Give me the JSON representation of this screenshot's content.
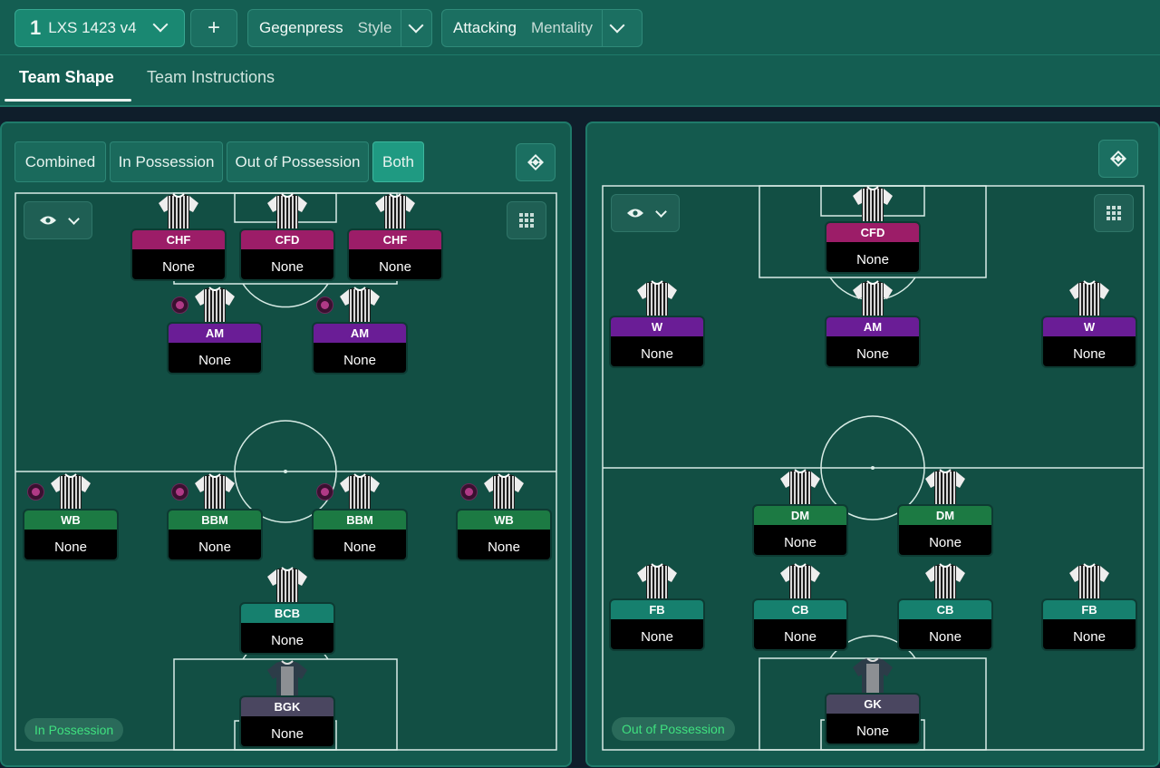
{
  "header": {
    "tactic_number": "1",
    "tactic_name": "LXS 1423 v4",
    "add_label": "+",
    "style_value": "Gegenpress",
    "style_label": "Style",
    "mentality_value": "Attacking",
    "mentality_label": "Mentality"
  },
  "tabs": {
    "team_shape": "Team Shape",
    "team_instructions": "Team Instructions"
  },
  "view_toggle": {
    "combined": "Combined",
    "in_possession": "In Possession",
    "out_of_possession": "Out of Possession",
    "both": "Both",
    "selected": "Both"
  },
  "left_pitch": {
    "badge": "In Possession",
    "players": [
      {
        "role": "CHF",
        "name": "None",
        "duty_icon": false,
        "color": "#9c1d68"
      },
      {
        "role": "CFD",
        "name": "None",
        "duty_icon": false,
        "color": "#9c1d68"
      },
      {
        "role": "CHF",
        "name": "None",
        "duty_icon": false,
        "color": "#9c1d68"
      },
      {
        "role": "AM",
        "name": "None",
        "duty_icon": true,
        "color": "#6a1d96"
      },
      {
        "role": "AM",
        "name": "None",
        "duty_icon": true,
        "color": "#6a1d96"
      },
      {
        "role": "WB",
        "name": "None",
        "duty_icon": true,
        "color": "#1c7a43"
      },
      {
        "role": "BBM",
        "name": "None",
        "duty_icon": true,
        "color": "#1c7a43"
      },
      {
        "role": "BBM",
        "name": "None",
        "duty_icon": true,
        "color": "#1c7a43"
      },
      {
        "role": "WB",
        "name": "None",
        "duty_icon": true,
        "color": "#1c7a43"
      },
      {
        "role": "BCB",
        "name": "None",
        "duty_icon": false,
        "color": "#16806e"
      },
      {
        "role": "BGK",
        "name": "None",
        "duty_icon": false,
        "color": "#4a4660"
      }
    ]
  },
  "right_pitch": {
    "badge": "Out of Possession",
    "players": [
      {
        "role": "CFD",
        "name": "None",
        "color": "#9c1d68"
      },
      {
        "role": "W",
        "name": "None",
        "color": "#6a1d96"
      },
      {
        "role": "AM",
        "name": "None",
        "color": "#6a1d96"
      },
      {
        "role": "W",
        "name": "None",
        "color": "#6a1d96"
      },
      {
        "role": "DM",
        "name": "None",
        "color": "#1c7a43"
      },
      {
        "role": "DM",
        "name": "None",
        "color": "#1c7a43"
      },
      {
        "role": "FB",
        "name": "None",
        "color": "#16806e"
      },
      {
        "role": "CB",
        "name": "None",
        "color": "#16806e"
      },
      {
        "role": "CB",
        "name": "None",
        "color": "#16806e"
      },
      {
        "role": "FB",
        "name": "None",
        "color": "#16806e"
      },
      {
        "role": "GK",
        "name": "None",
        "color": "#4a4660"
      }
    ]
  },
  "icons": {
    "tactic_dropdown": "chevron-down-icon",
    "swap": "swap-arrows-icon",
    "visibility": "eye-icon",
    "grid": "grid-icon",
    "shirt": "shirt-icon",
    "duty": "duty-dot-icon"
  }
}
